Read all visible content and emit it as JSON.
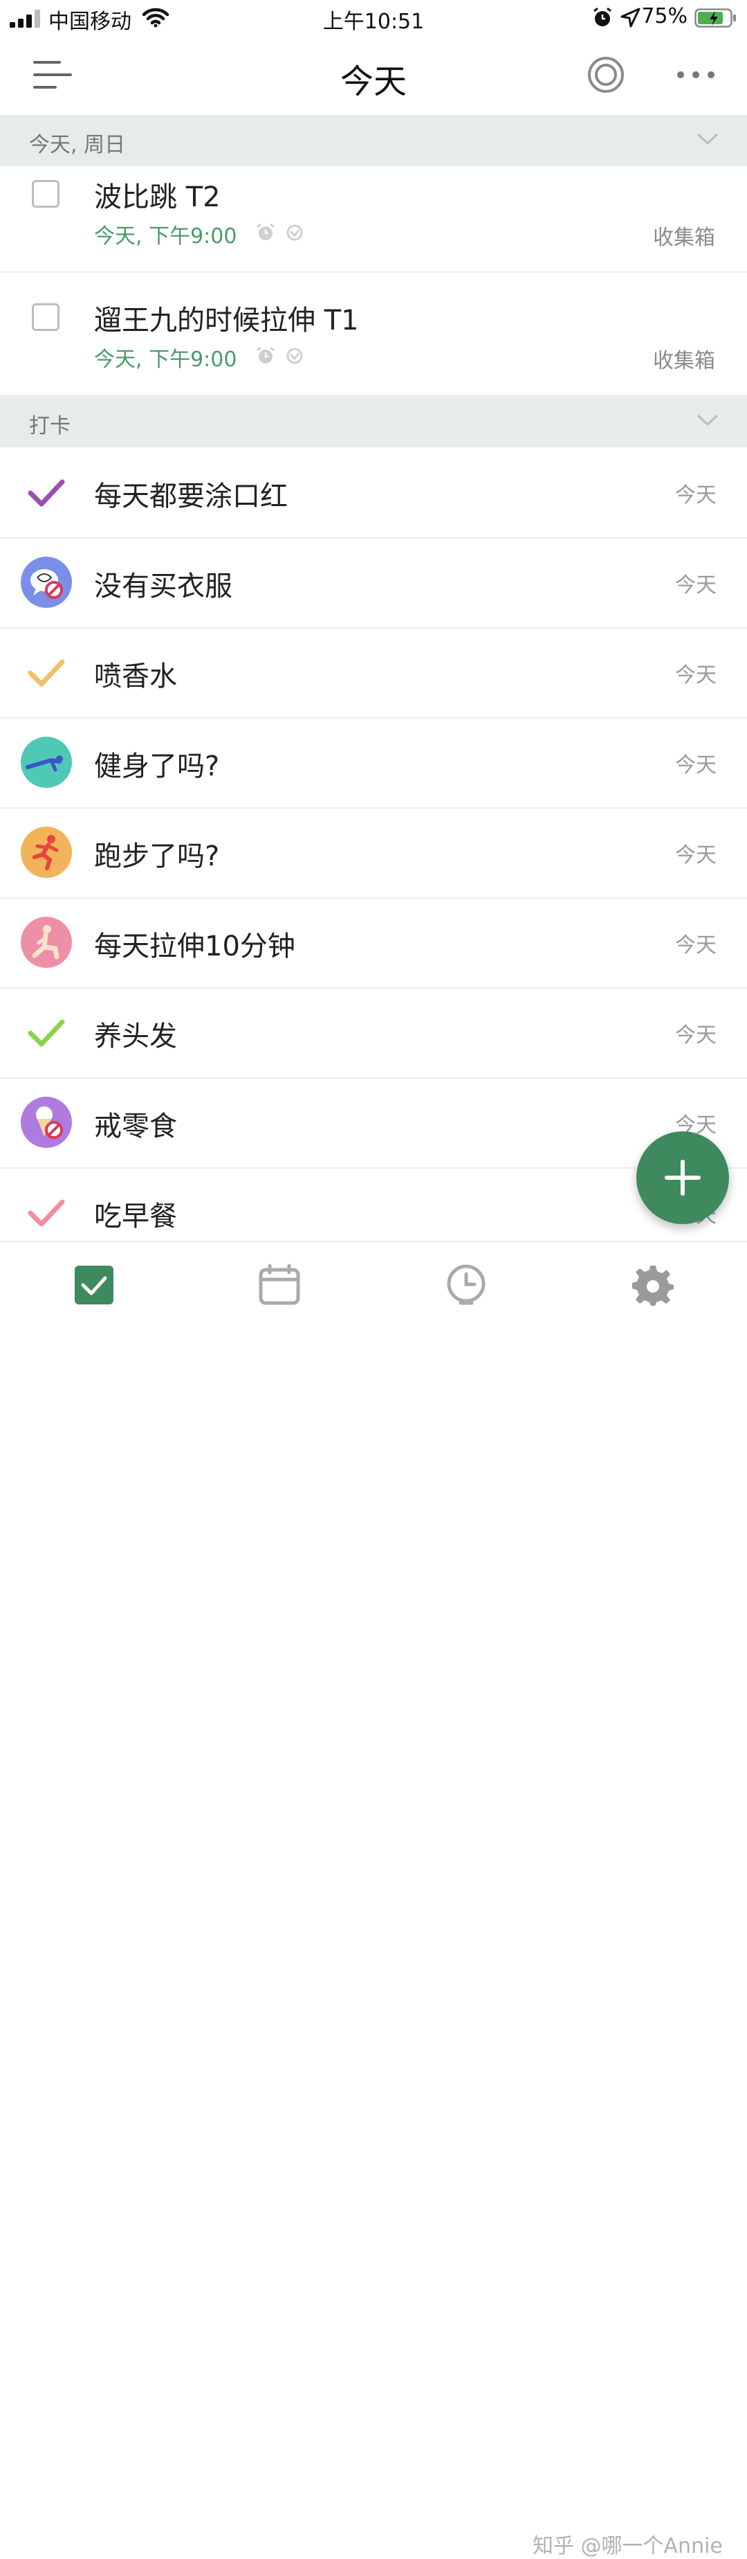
{
  "status_bar": {
    "carrier": "中国移动",
    "time": "上午10:51",
    "battery": "75%"
  },
  "header": {
    "title": "今天"
  },
  "sections": [
    {
      "label": "今天, 周日"
    },
    {
      "label": "打卡"
    }
  ],
  "tasks": [
    {
      "name": "波比跳 T2",
      "due": "今天, 下午9:00",
      "project": "收集箱"
    },
    {
      "name": "遛王九的时候拉伸 T1",
      "due": "今天, 下午9:00",
      "project": "收集箱"
    }
  ],
  "habits": [
    {
      "name": "每天都要涂口红",
      "date": "今天",
      "icon": "purple-check-icon"
    },
    {
      "name": "没有买衣服",
      "date": "今天",
      "icon": "no-shopping-icon"
    },
    {
      "name": "喷香水",
      "date": "今天",
      "icon": "yellow-check-icon"
    },
    {
      "name": "健身了吗?",
      "date": "今天",
      "icon": "workout-icon"
    },
    {
      "name": "跑步了吗?",
      "date": "今天",
      "icon": "running-icon"
    },
    {
      "name": "每天拉伸10分钟",
      "date": "今天",
      "icon": "stretch-icon"
    },
    {
      "name": "养头发",
      "date": "今天",
      "icon": "green-check-icon"
    },
    {
      "name": "戒零食",
      "date": "今天",
      "icon": "no-snack-icon"
    },
    {
      "name": "吃早餐",
      "date": "今天",
      "icon": "pink-check-icon"
    }
  ],
  "watermark": "知乎 @哪一个Annie",
  "colors": {
    "accent": "#3e8a5e",
    "section_bg": "#e6ece8",
    "due_text": "#4a9a6a"
  }
}
